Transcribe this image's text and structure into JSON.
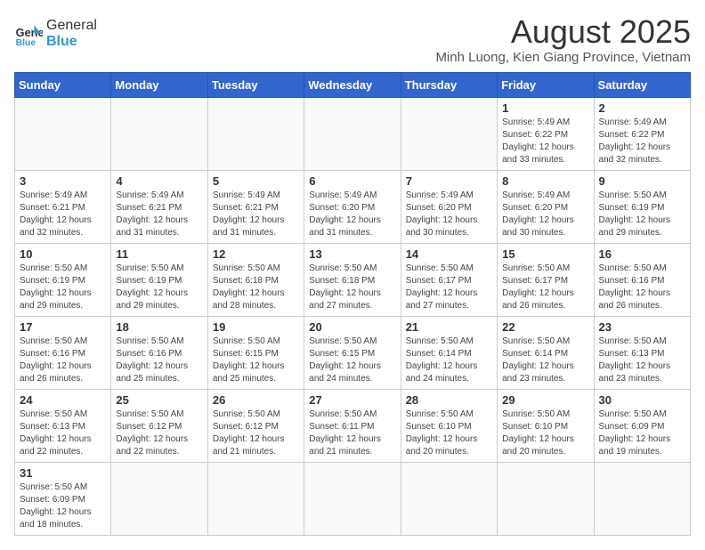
{
  "logo": {
    "text_general": "General",
    "text_blue": "Blue"
  },
  "title": {
    "month_year": "August 2025",
    "location": "Minh Luong, Kien Giang Province, Vietnam"
  },
  "weekdays": [
    "Sunday",
    "Monday",
    "Tuesday",
    "Wednesday",
    "Thursday",
    "Friday",
    "Saturday"
  ],
  "days": [
    {
      "date": "",
      "info": ""
    },
    {
      "date": "",
      "info": ""
    },
    {
      "date": "",
      "info": ""
    },
    {
      "date": "",
      "info": ""
    },
    {
      "date": "",
      "info": ""
    },
    {
      "date": "1",
      "info": "Sunrise: 5:49 AM\nSunset: 6:22 PM\nDaylight: 12 hours\nand 33 minutes."
    },
    {
      "date": "2",
      "info": "Sunrise: 5:49 AM\nSunset: 6:22 PM\nDaylight: 12 hours\nand 32 minutes."
    },
    {
      "date": "3",
      "info": "Sunrise: 5:49 AM\nSunset: 6:21 PM\nDaylight: 12 hours\nand 32 minutes."
    },
    {
      "date": "4",
      "info": "Sunrise: 5:49 AM\nSunset: 6:21 PM\nDaylight: 12 hours\nand 31 minutes."
    },
    {
      "date": "5",
      "info": "Sunrise: 5:49 AM\nSunset: 6:21 PM\nDaylight: 12 hours\nand 31 minutes."
    },
    {
      "date": "6",
      "info": "Sunrise: 5:49 AM\nSunset: 6:20 PM\nDaylight: 12 hours\nand 31 minutes."
    },
    {
      "date": "7",
      "info": "Sunrise: 5:49 AM\nSunset: 6:20 PM\nDaylight: 12 hours\nand 30 minutes."
    },
    {
      "date": "8",
      "info": "Sunrise: 5:49 AM\nSunset: 6:20 PM\nDaylight: 12 hours\nand 30 minutes."
    },
    {
      "date": "9",
      "info": "Sunrise: 5:50 AM\nSunset: 6:19 PM\nDaylight: 12 hours\nand 29 minutes."
    },
    {
      "date": "10",
      "info": "Sunrise: 5:50 AM\nSunset: 6:19 PM\nDaylight: 12 hours\nand 29 minutes."
    },
    {
      "date": "11",
      "info": "Sunrise: 5:50 AM\nSunset: 6:19 PM\nDaylight: 12 hours\nand 29 minutes."
    },
    {
      "date": "12",
      "info": "Sunrise: 5:50 AM\nSunset: 6:18 PM\nDaylight: 12 hours\nand 28 minutes."
    },
    {
      "date": "13",
      "info": "Sunrise: 5:50 AM\nSunset: 6:18 PM\nDaylight: 12 hours\nand 27 minutes."
    },
    {
      "date": "14",
      "info": "Sunrise: 5:50 AM\nSunset: 6:17 PM\nDaylight: 12 hours\nand 27 minutes."
    },
    {
      "date": "15",
      "info": "Sunrise: 5:50 AM\nSunset: 6:17 PM\nDaylight: 12 hours\nand 26 minutes."
    },
    {
      "date": "16",
      "info": "Sunrise: 5:50 AM\nSunset: 6:16 PM\nDaylight: 12 hours\nand 26 minutes."
    },
    {
      "date": "17",
      "info": "Sunrise: 5:50 AM\nSunset: 6:16 PM\nDaylight: 12 hours\nand 26 minutes."
    },
    {
      "date": "18",
      "info": "Sunrise: 5:50 AM\nSunset: 6:16 PM\nDaylight: 12 hours\nand 25 minutes."
    },
    {
      "date": "19",
      "info": "Sunrise: 5:50 AM\nSunset: 6:15 PM\nDaylight: 12 hours\nand 25 minutes."
    },
    {
      "date": "20",
      "info": "Sunrise: 5:50 AM\nSunset: 6:15 PM\nDaylight: 12 hours\nand 24 minutes."
    },
    {
      "date": "21",
      "info": "Sunrise: 5:50 AM\nSunset: 6:14 PM\nDaylight: 12 hours\nand 24 minutes."
    },
    {
      "date": "22",
      "info": "Sunrise: 5:50 AM\nSunset: 6:14 PM\nDaylight: 12 hours\nand 23 minutes."
    },
    {
      "date": "23",
      "info": "Sunrise: 5:50 AM\nSunset: 6:13 PM\nDaylight: 12 hours\nand 23 minutes."
    },
    {
      "date": "24",
      "info": "Sunrise: 5:50 AM\nSunset: 6:13 PM\nDaylight: 12 hours\nand 22 minutes."
    },
    {
      "date": "25",
      "info": "Sunrise: 5:50 AM\nSunset: 6:12 PM\nDaylight: 12 hours\nand 22 minutes."
    },
    {
      "date": "26",
      "info": "Sunrise: 5:50 AM\nSunset: 6:12 PM\nDaylight: 12 hours\nand 21 minutes."
    },
    {
      "date": "27",
      "info": "Sunrise: 5:50 AM\nSunset: 6:11 PM\nDaylight: 12 hours\nand 21 minutes."
    },
    {
      "date": "28",
      "info": "Sunrise: 5:50 AM\nSunset: 6:10 PM\nDaylight: 12 hours\nand 20 minutes."
    },
    {
      "date": "29",
      "info": "Sunrise: 5:50 AM\nSunset: 6:10 PM\nDaylight: 12 hours\nand 20 minutes."
    },
    {
      "date": "30",
      "info": "Sunrise: 5:50 AM\nSunset: 6:09 PM\nDaylight: 12 hours\nand 19 minutes."
    },
    {
      "date": "31",
      "info": "Sunrise: 5:50 AM\nSunset: 6:09 PM\nDaylight: 12 hours\nand 18 minutes."
    },
    {
      "date": "",
      "info": ""
    },
    {
      "date": "",
      "info": ""
    },
    {
      "date": "",
      "info": ""
    },
    {
      "date": "",
      "info": ""
    },
    {
      "date": "",
      "info": ""
    },
    {
      "date": "",
      "info": ""
    }
  ]
}
